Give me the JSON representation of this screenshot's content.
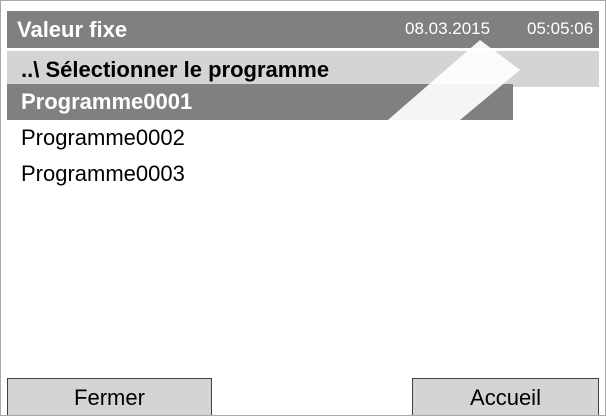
{
  "header": {
    "title": "Valeur fixe",
    "date": "08.03.2015",
    "time": "05:05:06"
  },
  "subheader": {
    "title": "..\\ Sélectionner le programme"
  },
  "programs": [
    {
      "label": "Programme0001",
      "selected": true
    },
    {
      "label": "Programme0002",
      "selected": false
    },
    {
      "label": "Programme0003",
      "selected": false
    }
  ],
  "buttons": {
    "close_label": "Fermer",
    "home_label": "Accueil"
  },
  "colors": {
    "title_bar": "#808080",
    "subtitle_bar": "#d4d4d4",
    "selection": "#808080",
    "button_face": "#d4d4d4"
  }
}
